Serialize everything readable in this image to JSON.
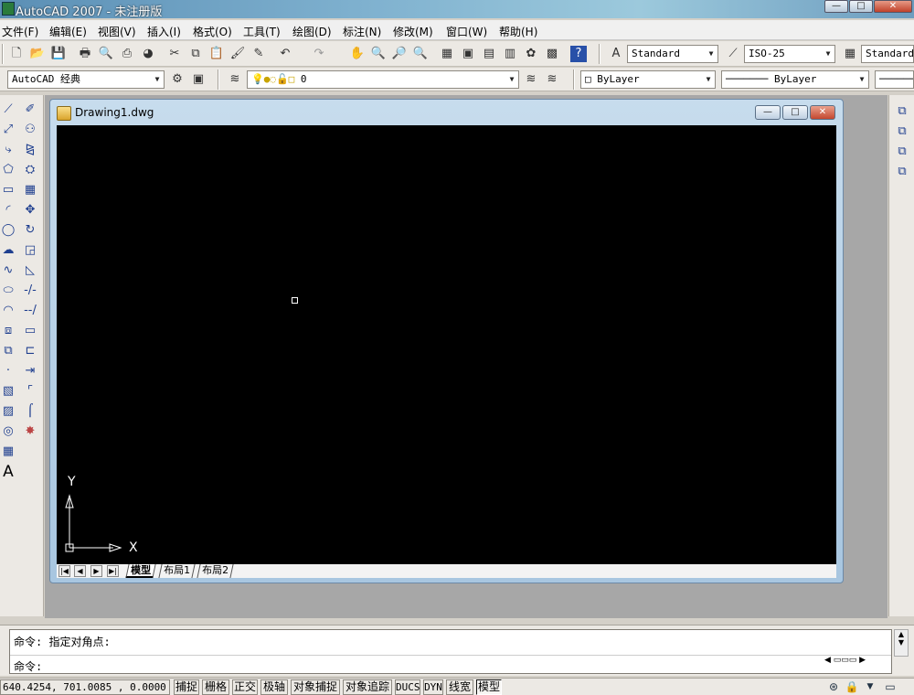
{
  "window": {
    "title": "AutoCAD 2007 - 未注册版",
    "minimize": "—",
    "maximize": "□",
    "close": "✕"
  },
  "menus": [
    "文件(F)",
    "编辑(E)",
    "视图(V)",
    "插入(I)",
    "格式(O)",
    "工具(T)",
    "绘图(D)",
    "标注(N)",
    "修改(M)",
    "窗口(W)",
    "帮助(H)"
  ],
  "styles_toolbar": {
    "text_style": "Standard",
    "dim_style": "ISO-25",
    "table_style": "Standard"
  },
  "workspace_toolbar": {
    "workspace": "AutoCAD 经典",
    "layer": "0",
    "color": "ByLayer",
    "linetype": "ByLayer"
  },
  "drawing": {
    "title": "Drawing1.dwg",
    "minimize": "—",
    "maximize": "□",
    "close": "✕",
    "ucs_x": "X",
    "ucs_y": "Y",
    "tabs": [
      "模型",
      "布局1",
      "布局2"
    ],
    "active_tab": "模型"
  },
  "command": {
    "history_line": "命令: 指定对角点:",
    "prompt": "命令:"
  },
  "status": {
    "coordinates": "640.4254,  701.0085 , 0.0000",
    "toggles": [
      "捕捉",
      "栅格",
      "正交",
      "极轴",
      "对象捕捉",
      "对象追踪",
      "DUCS",
      "DYN",
      "线宽",
      "模型"
    ]
  },
  "icons": {
    "draw_palette": [
      "line-icon",
      "construction-line-icon",
      "polyline-icon",
      "polygon-icon",
      "rectangle-icon",
      "arc-icon",
      "circle-icon",
      "revision-cloud-icon",
      "spline-icon",
      "ellipse-icon",
      "ellipse-arc-icon",
      "insert-block-icon",
      "make-block-icon",
      "point-icon",
      "hatch-icon",
      "gradient-icon",
      "region-icon",
      "table-icon",
      "multiline-text-icon"
    ],
    "modify_palette": [
      "erase-icon",
      "copy-icon",
      "mirror-icon",
      "offset-icon",
      "array-icon",
      "move-icon",
      "rotate-icon",
      "scale-icon",
      "stretch-icon",
      "trim-icon",
      "extend-icon",
      "break-at-point-icon",
      "break-icon",
      "join-icon",
      "chamfer-icon",
      "fillet-icon",
      "explode-icon"
    ]
  }
}
